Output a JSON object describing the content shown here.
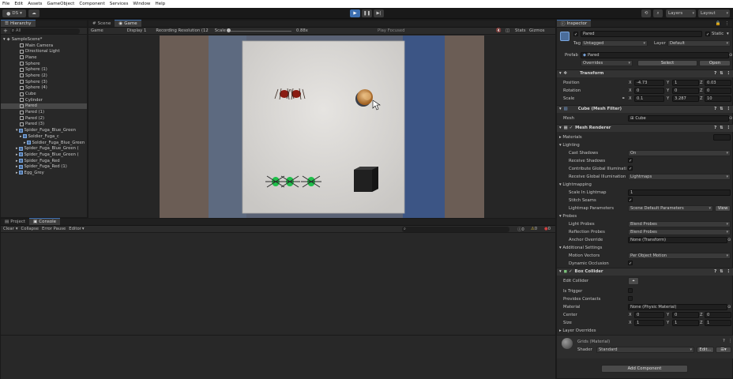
{
  "menu": [
    "File",
    "Edit",
    "Assets",
    "GameObject",
    "Component",
    "Services",
    "Window",
    "Help"
  ],
  "toolbar": {
    "account": "DS",
    "layers": "Layers",
    "layout": "Layout"
  },
  "hierarchy": {
    "tab": "Hierarchy",
    "search_hint": "All",
    "scene": "SampleScene*",
    "items": [
      "Main Camera",
      "Directional Light",
      "Plane",
      "Sphere",
      "Sphere (1)",
      "Sphere (2)",
      "Sphere (3)",
      "Sphere (4)",
      "Cube",
      "Cylinder",
      "Pared",
      "Pared (1)",
      "Pared (2)",
      "Pared (3)",
      "Spider_Fuga_Blue_Green",
      "Soldier_Fuga_c",
      "Soldier_Fuga_Blue_Green",
      "Spider_Fuga_Blue_Green (",
      "Spider_Fuga_Blue_Green (",
      "Spider_Fuga_Red",
      "Spider_Fuga_Red (1)",
      "Egg_Grey"
    ],
    "selected": "Pared"
  },
  "game": {
    "tabs": [
      "Scene",
      "Game"
    ],
    "active_tab": "Game",
    "view": "Game",
    "display": "Display 1",
    "resolution": "Recording Resolution (12",
    "scale_label": "Scale",
    "scale_value": "0.88x",
    "play_focused": "Play Focused",
    "stats": "Stats",
    "gizmos": "Gizmos"
  },
  "console": {
    "tabs": [
      "Project",
      "Console"
    ],
    "active_tab": "Console",
    "clear": "Clear",
    "collapse": "Collapse",
    "error_pause": "Error Pause",
    "editor": "Editor",
    "counts": [
      "0",
      "0",
      "0"
    ]
  },
  "inspector": {
    "tab": "Inspector",
    "object_name": "Pared",
    "static_label": "Static",
    "tag_label": "Tag",
    "tag": "Untagged",
    "layer_label": "Layer",
    "layer": "Default",
    "prefab_label": "Prefab",
    "prefab": "Pared",
    "overrides": "Overrides",
    "select": "Select",
    "open": "Open",
    "transform": {
      "title": "Transform",
      "position_label": "Position",
      "position": [
        "-4.73",
        "1",
        "0.03"
      ],
      "rotation_label": "Rotation",
      "rotation": [
        "0",
        "0",
        "0"
      ],
      "scale_label": "Scale",
      "scale": [
        "0.1",
        "3.287",
        "10"
      ]
    },
    "mesh_filter": {
      "title": "Cube (Mesh Filter)",
      "mesh_label": "Mesh",
      "mesh": "Cube"
    },
    "mesh_renderer": {
      "title": "Mesh Renderer",
      "materials": "Materials",
      "lighting": "Lighting",
      "cast_shadows_label": "Cast Shadows",
      "cast_shadows": "On",
      "receive_shadows_label": "Receive Shadows",
      "contribute_gi_label": "Contribute Global Illuminati",
      "receive_gi_label": "Receive Global Illumination",
      "receive_gi": "Lightmaps",
      "lightmapping": "Lightmapping",
      "scale_in_lightmap_label": "Scale In Lightmap",
      "scale_in_lightmap": "1",
      "stitch_seams_label": "Stitch Seams",
      "lightmap_params_label": "Lightmap Parameters",
      "lightmap_params": "Scene Default Parameters",
      "view": "View",
      "probes": "Probes",
      "light_probes_label": "Light Probes",
      "light_probes": "Blend Probes",
      "reflection_probes_label": "Reflection Probes",
      "reflection_probes": "Blend Probes",
      "anchor_override_label": "Anchor Override",
      "anchor_override": "None (Transform)",
      "additional": "Additional Settings",
      "motion_vectors_label": "Motion Vectors",
      "motion_vectors": "Per Object Motion",
      "dynamic_occlusion_label": "Dynamic Occlusion"
    },
    "box_collider": {
      "title": "Box Collider",
      "edit_collider": "Edit Collider",
      "is_trigger": "Is Trigger",
      "provides_contacts": "Provides Contacts",
      "material_label": "Material",
      "material": "None (Physic Material)",
      "center_label": "Center",
      "center": [
        "0",
        "0",
        "0"
      ],
      "size_label": "Size",
      "size": [
        "1",
        "1",
        "1"
      ],
      "layer_overrides": "Layer Overrides"
    },
    "material": {
      "name": "Grids (Material)",
      "shader_label": "Shader",
      "shader": "Standard",
      "edit": "Edit..."
    },
    "add_component": "Add Component"
  }
}
